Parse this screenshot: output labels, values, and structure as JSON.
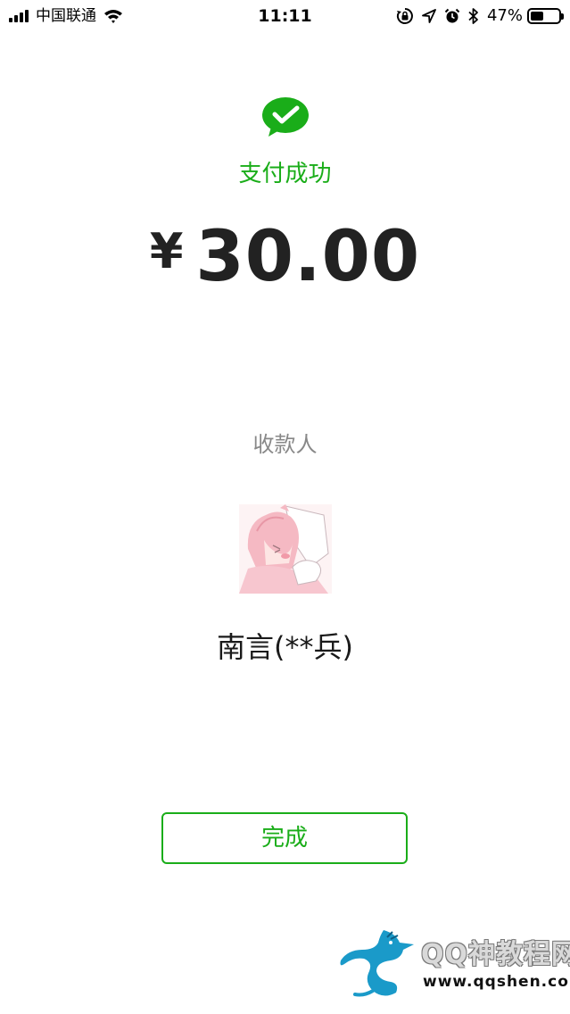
{
  "status_bar": {
    "carrier": "中国联通",
    "time": "11:11",
    "battery_percent": "47%",
    "battery_level": 0.47,
    "icons": [
      "signal-icon",
      "wifi-icon",
      "rotation-lock-icon",
      "location-icon",
      "alarm-icon",
      "bluetooth-icon",
      "battery-icon"
    ]
  },
  "payment": {
    "status_icon": "wechat-pay-check-icon",
    "status_text": "支付成功",
    "currency_symbol": "¥",
    "amount": "30.00",
    "payee_label": "收款人",
    "payee_name": "南言(**兵)",
    "avatar": "payee-avatar-image"
  },
  "actions": {
    "done_label": "完成"
  },
  "watermark": {
    "logo": "dragon-logo",
    "title": "QQ神教程网",
    "url": "www.qqshen.com"
  },
  "colors": {
    "accent": "#1aad19",
    "secondary_text": "#888888",
    "primary_text": "#1a1a1a"
  }
}
